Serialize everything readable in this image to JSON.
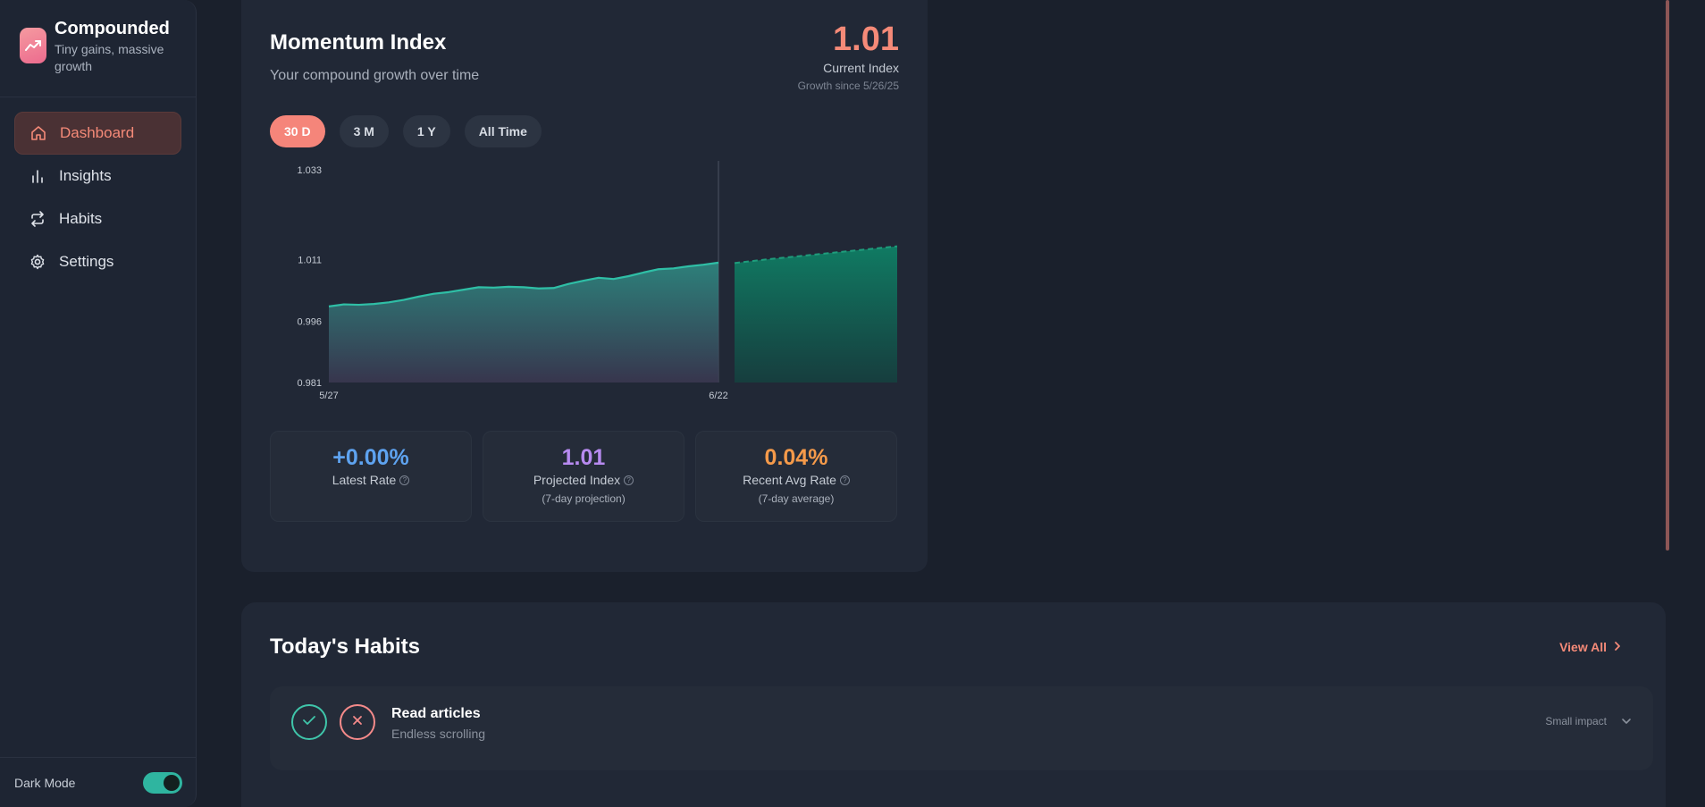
{
  "brand": {
    "name": "Compounded",
    "tagline": "Tiny gains, massive growth",
    "logo_icon": "trending-up-icon"
  },
  "nav": [
    {
      "label": "Dashboard",
      "icon": "home-icon",
      "active": true
    },
    {
      "label": "Insights",
      "icon": "bar-chart-icon",
      "active": false
    },
    {
      "label": "Habits",
      "icon": "repeat-icon",
      "active": false
    },
    {
      "label": "Settings",
      "icon": "gear-icon",
      "active": false
    }
  ],
  "dark_mode": {
    "label": "Dark Mode",
    "on": true
  },
  "momentum": {
    "title": "Momentum Index",
    "subtitle": "Your compound growth over time",
    "value": "1.01",
    "value_label": "Current Index",
    "since": "Growth since 5/26/25",
    "ranges": [
      "30 D",
      "3 M",
      "1 Y",
      "All Time"
    ],
    "active_range": "30 D"
  },
  "chart_data": {
    "type": "area",
    "x_ticks": [
      "5/27",
      "6/22"
    ],
    "y_ticks": [
      "1.033",
      "1.011",
      "0.996",
      "0.981"
    ],
    "ylim": [
      0.981,
      1.033
    ],
    "series": [
      {
        "values": [
          0.9996,
          1.0001,
          1.0,
          1.0002,
          1.0006,
          1.0012,
          1.002,
          1.0027,
          1.0031,
          1.0037,
          1.0043,
          1.0042,
          1.0044,
          1.0043,
          1.004,
          1.0041,
          1.0051,
          1.0059,
          1.0066,
          1.0063,
          1.007,
          1.0079,
          1.0087,
          1.0089,
          1.0094,
          1.0098,
          1.0103
        ]
      },
      {
        "values": [
          1.0102,
          1.0111,
          1.0119,
          1.0127,
          1.0135,
          1.0143
        ]
      }
    ],
    "colors": {
      "line": "#2fbfa6",
      "projection": "#1f9d7c"
    }
  },
  "stats": [
    {
      "value": "+0.00%",
      "label": "Latest Rate",
      "sub": "",
      "color": "#5ea3f0"
    },
    {
      "value": "1.01",
      "label": "Projected Index",
      "sub": "(7-day projection)",
      "color": "#b78af0"
    },
    {
      "value": "0.04%",
      "label": "Recent Avg Rate",
      "sub": "(7-day average)",
      "color": "#f59a4a"
    }
  ],
  "habits": {
    "title": "Today's Habits",
    "view_all": "View All",
    "items": [
      {
        "name": "Read articles",
        "sub": "Endless scrolling",
        "impact": "Small impact"
      }
    ]
  }
}
